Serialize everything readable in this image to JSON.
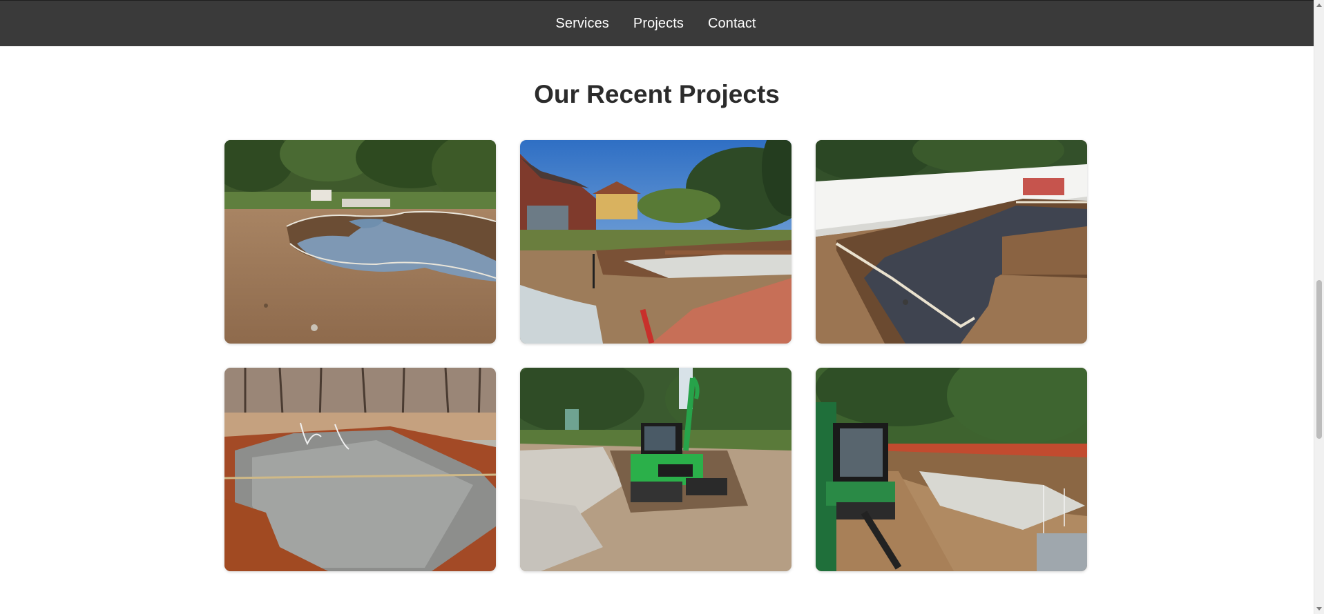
{
  "nav": {
    "items": [
      {
        "label": "Services"
      },
      {
        "label": "Projects"
      },
      {
        "label": "Contact"
      }
    ]
  },
  "projects": {
    "heading": "Our Recent Projects",
    "photos": [
      {
        "name": "project-photo-freeform-pool-excavation"
      },
      {
        "name": "project-photo-pool-dig-by-brick-house"
      },
      {
        "name": "project-photo-l-shaped-pool-by-fence"
      },
      {
        "name": "project-photo-rectangular-pool-in-woods"
      },
      {
        "name": "project-photo-excavator-demolition"
      },
      {
        "name": "project-photo-excavator-at-pool-site"
      }
    ]
  },
  "colors": {
    "navbar": "#3a3a3a",
    "heading": "#2b2b2b",
    "background": "#ffffff"
  }
}
